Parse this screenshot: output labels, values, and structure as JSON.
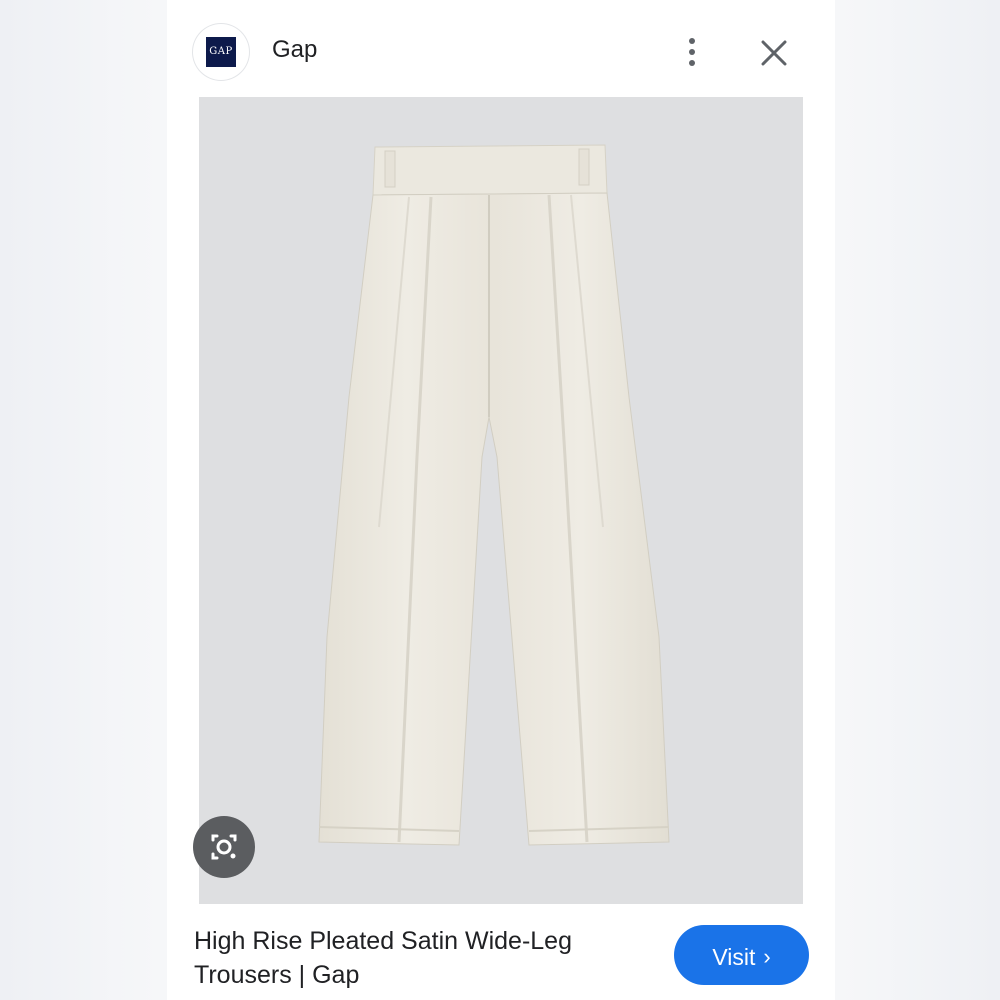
{
  "header": {
    "logo_text": "GAP",
    "site_name": "Gap",
    "more_icon": "more-vert-icon",
    "close_icon": "close-icon"
  },
  "image": {
    "alt": "High Rise Pleated Satin Wide-Leg Trousers | Gap",
    "lens_icon": "lens-icon"
  },
  "result": {
    "title": "High Rise Pleated Satin Wide-Leg Trousers | Gap",
    "visit_label": "Visit",
    "visit_icon": "›"
  },
  "colors": {
    "accent": "#1a73e8",
    "logo_bg": "#0d1a4b",
    "product": "#ebe7dd"
  }
}
